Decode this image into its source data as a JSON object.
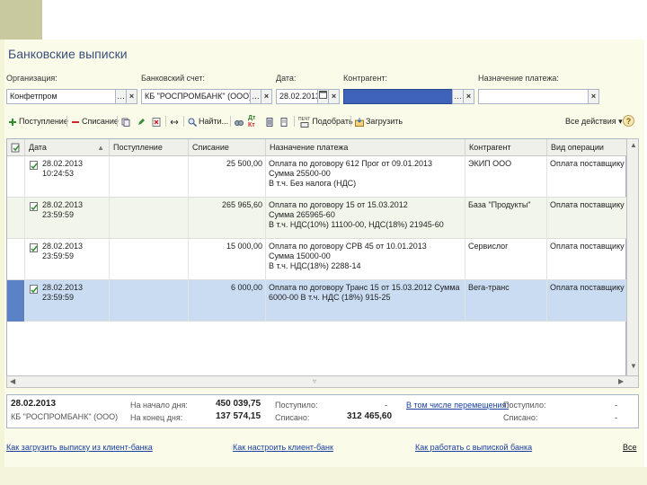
{
  "window_title": "Банковские выписки",
  "filters": {
    "org_label": "Организация:",
    "org_value": "Конфетпром",
    "account_label": "Банковский счет:",
    "account_value": "КБ \"РОСПРОМБАНК\" (ООО) (40",
    "date_label": "Дата:",
    "date_value": "28.02.2013",
    "contractor_label": "Контрагент:",
    "contractor_value": "",
    "purpose_label": "Назначение платежа:",
    "purpose_value": ""
  },
  "toolbar": {
    "receipt": "Поступление",
    "writeoff": "Списание",
    "find": "Найти...",
    "select": "Подобрать",
    "load": "Загрузить",
    "all_actions": "Все действия ▾",
    "help": "?",
    "dt_label": "Дт",
    "kt_label": "Кт",
    "mark_label": "ПЕЧТ"
  },
  "table": {
    "columns": [
      "Дата",
      "Поступление",
      "Списание",
      "Назначение платежа",
      "Контрагент",
      "Вид операции"
    ],
    "rows": [
      {
        "date": "28.02.2013",
        "time": "10:24:53",
        "receipt": "",
        "writeoff": "25 500,00",
        "purpose1": "Оплата по договору 612 Прог от 09.01.2013",
        "purpose2": "Сумма 25500-00",
        "purpose3": "В т.ч. Без налога (НДС)",
        "contractor": "ЭКИП ООО",
        "operation": "Оплата поставщику"
      },
      {
        "date": "28.02.2013",
        "time": "23:59:59",
        "receipt": "",
        "writeoff": "265 965,60",
        "purpose1": "Оплата по договору 15 от 15.03.2012",
        "purpose2": "Сумма 265965-60",
        "purpose3": "В т.ч. НДС(10%) 11100-00, НДС(18%) 21945-60",
        "contractor": "База \"Продукты\"",
        "operation": "Оплата поставщику"
      },
      {
        "date": "28.02.2013",
        "time": "23:59:59",
        "receipt": "",
        "writeoff": "15 000,00",
        "purpose1": "Оплата по договору СРВ 45 от 10.01.2013",
        "purpose2": "Сумма 15000-00",
        "purpose3": "В т.ч. НДС(18%) 2288-14",
        "contractor": "Сервислог",
        "operation": "Оплата поставщику"
      },
      {
        "date": "28.02.2013",
        "time": "23:59:59",
        "receipt": "",
        "writeoff": "6 000,00",
        "purpose1": "Оплата по договору Транс 15 от 15.03.2012 Сумма",
        "purpose2": "6000-00 В т.ч. НДС  (18%) 915-25",
        "purpose3": "",
        "contractor": "Вега-транс",
        "operation": "Оплата поставщику"
      }
    ]
  },
  "summary": {
    "date": "28.02.2013",
    "bank": "КБ \"РОСПРОМБАНК\" (ООО)",
    "start_label": "На начало дня:",
    "start_value": "450 039,75",
    "end_label": "На конец дня:",
    "end_value": "137 574,15",
    "received_label": "Поступило:",
    "received_value": "-",
    "spent_label": "Списано:",
    "spent_value": "312 465,60",
    "transfers_link": "В том числе перемещения:",
    "tr_received_label": "Поступило:",
    "tr_received_value": "-",
    "tr_spent_label": "Списано:",
    "tr_spent_value": "-"
  },
  "bottom_links": {
    "link1": "Как загрузить выписку из клиент-банка",
    "link2": "Как настроить клиент-банк",
    "link3": "Как работать с выпиской банка",
    "link4": "Все"
  },
  "colors": {
    "title": "#3b4f7a",
    "selected_row": "#c9dcf2",
    "link": "#1a3fa0",
    "selected_field": "#3e63b8"
  }
}
